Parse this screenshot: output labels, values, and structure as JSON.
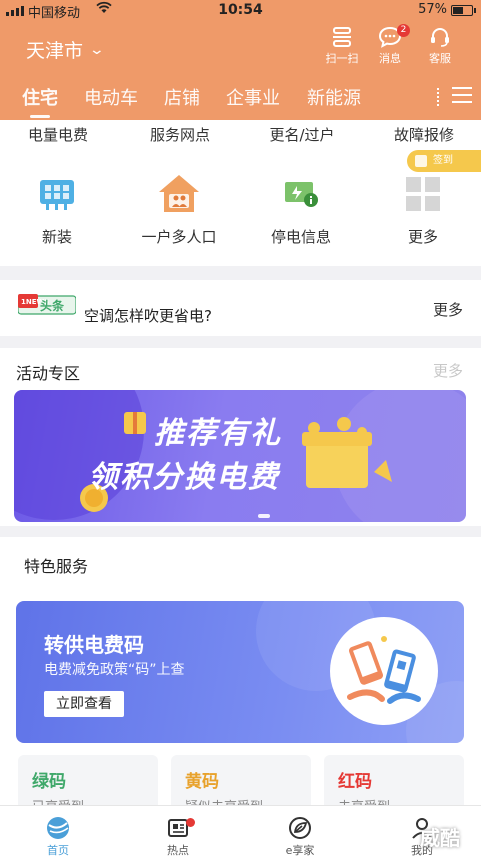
{
  "status_bar": {
    "carrier": "中国移动",
    "time": "10:54",
    "battery": "57%"
  },
  "header": {
    "city": "天津市",
    "icons": [
      {
        "name": "scan-icon",
        "label": "扫一扫"
      },
      {
        "name": "message-icon",
        "label": "消息",
        "badge": "2"
      },
      {
        "name": "headset-icon",
        "label": "客服"
      }
    ],
    "tabs": [
      "住宅",
      "电动车",
      "店铺",
      "企事业",
      "新能源"
    ],
    "active_tab": "住宅"
  },
  "services": {
    "text_row": [
      "电量电费",
      "服务网点",
      "更名/过户",
      "故障报修"
    ],
    "icon_row": [
      {
        "icon": "meter-icon",
        "label": "新装"
      },
      {
        "icon": "house-family-icon",
        "label": "一户多人口"
      },
      {
        "icon": "power-outage-icon",
        "label": "停电信息"
      },
      {
        "icon": "more-grid-icon",
        "label": "更多"
      }
    ],
    "signin": "签到"
  },
  "news": {
    "logo_top": "1NEWS",
    "logo_text": "头条",
    "headline": "空调怎样吹更省电?",
    "more": "更多"
  },
  "activity": {
    "title": "活动专区",
    "more": "更多",
    "banner": {
      "line1": "推荐有礼",
      "line2": "领积分换电费"
    }
  },
  "featured": {
    "title": "特色服务",
    "card": {
      "title": "转供电费码",
      "subtitle": "电费减免政策“码”上查",
      "button": "立即查看"
    },
    "codes": [
      {
        "title": "绿码",
        "status": "已享受到",
        "color": "#3fa86a"
      },
      {
        "title": "黄码",
        "status": "疑似未享受到",
        "color": "#e8a22c"
      },
      {
        "title": "红码",
        "status": "未享受到",
        "color": "#e53935"
      }
    ]
  },
  "bottom_nav": [
    {
      "icon": "home-globe-icon",
      "label": "首页",
      "active": true
    },
    {
      "icon": "hot-news-icon",
      "label": "热点"
    },
    {
      "icon": "leaf-icon",
      "label": "e享家"
    },
    {
      "icon": "profile-icon",
      "label": "我的"
    }
  ],
  "watermark": "威酷"
}
